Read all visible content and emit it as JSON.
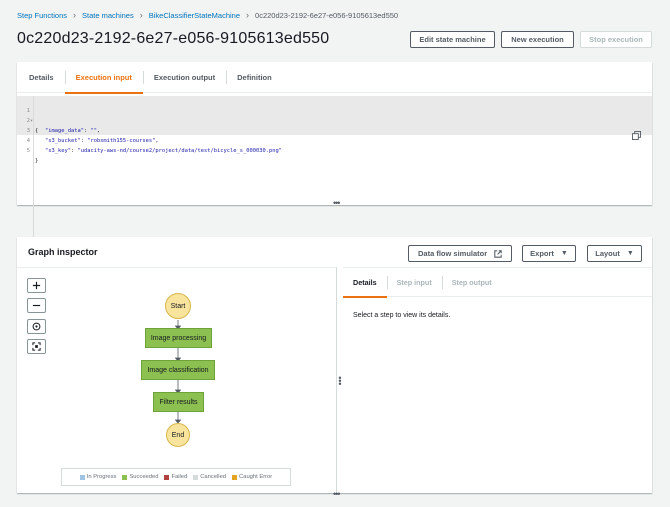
{
  "breadcrumb": {
    "items": [
      "Step Functions",
      "State machines",
      "BikeClassifierStateMachine"
    ],
    "current": "0c220d23-2192-6e27-e056-9105613ed550"
  },
  "page": {
    "title": "0c220d23-2192-6e27-e056-9105613ed550"
  },
  "header_buttons": {
    "edit": "Edit state machine",
    "new_execution": "New execution",
    "stop_execution": "Stop execution"
  },
  "execution_tabs": [
    "Details",
    "Execution input",
    "Execution output",
    "Definition"
  ],
  "active_execution_tab": "Execution input",
  "editor": {
    "line_numbers": [
      "1",
      "2",
      "3",
      "4",
      "5"
    ],
    "fold_marker": "▾",
    "lines": {
      "l1": "{",
      "image_data_key": "\"image_data\"",
      "image_data_val": "\"\"",
      "s3_bucket_key": "\"s3_bucket\"",
      "s3_bucket_val": "\"robsmith155-courses\"",
      "s3_key_key": "\"s3_key\"",
      "s3_key_val": "\"udacity-aws-nd/course2/project/data/test/bicycle_s_000030.png\"",
      "l5": "}"
    }
  },
  "graph": {
    "title": "Graph inspector",
    "buttons": {
      "data_flow": "Data flow simulator",
      "export": "Export",
      "layout": "Layout"
    },
    "nodes": {
      "start": "Start",
      "image_processing": "Image processing",
      "image_classification": "Image classification",
      "filter_results": "Filter results",
      "end": "End"
    },
    "legend": [
      {
        "label": "In Progress",
        "color": "#a0c4e4"
      },
      {
        "label": "Succeeded",
        "color": "#8cc051"
      },
      {
        "label": "Failed",
        "color": "#b0413e"
      },
      {
        "label": "Cancelled",
        "color": "#d5dbdb"
      },
      {
        "label": "Caught Error",
        "color": "#e3a51f"
      }
    ]
  },
  "details_panel": {
    "tabs": [
      "Details",
      "Step input",
      "Step output"
    ],
    "active_tab": "Details",
    "message": "Select a step to view its details."
  },
  "colors": {
    "accent": "#ec7211",
    "link": "#0073bb",
    "state_fill": "#8cc051",
    "terminal_fill": "#f8e49d"
  }
}
